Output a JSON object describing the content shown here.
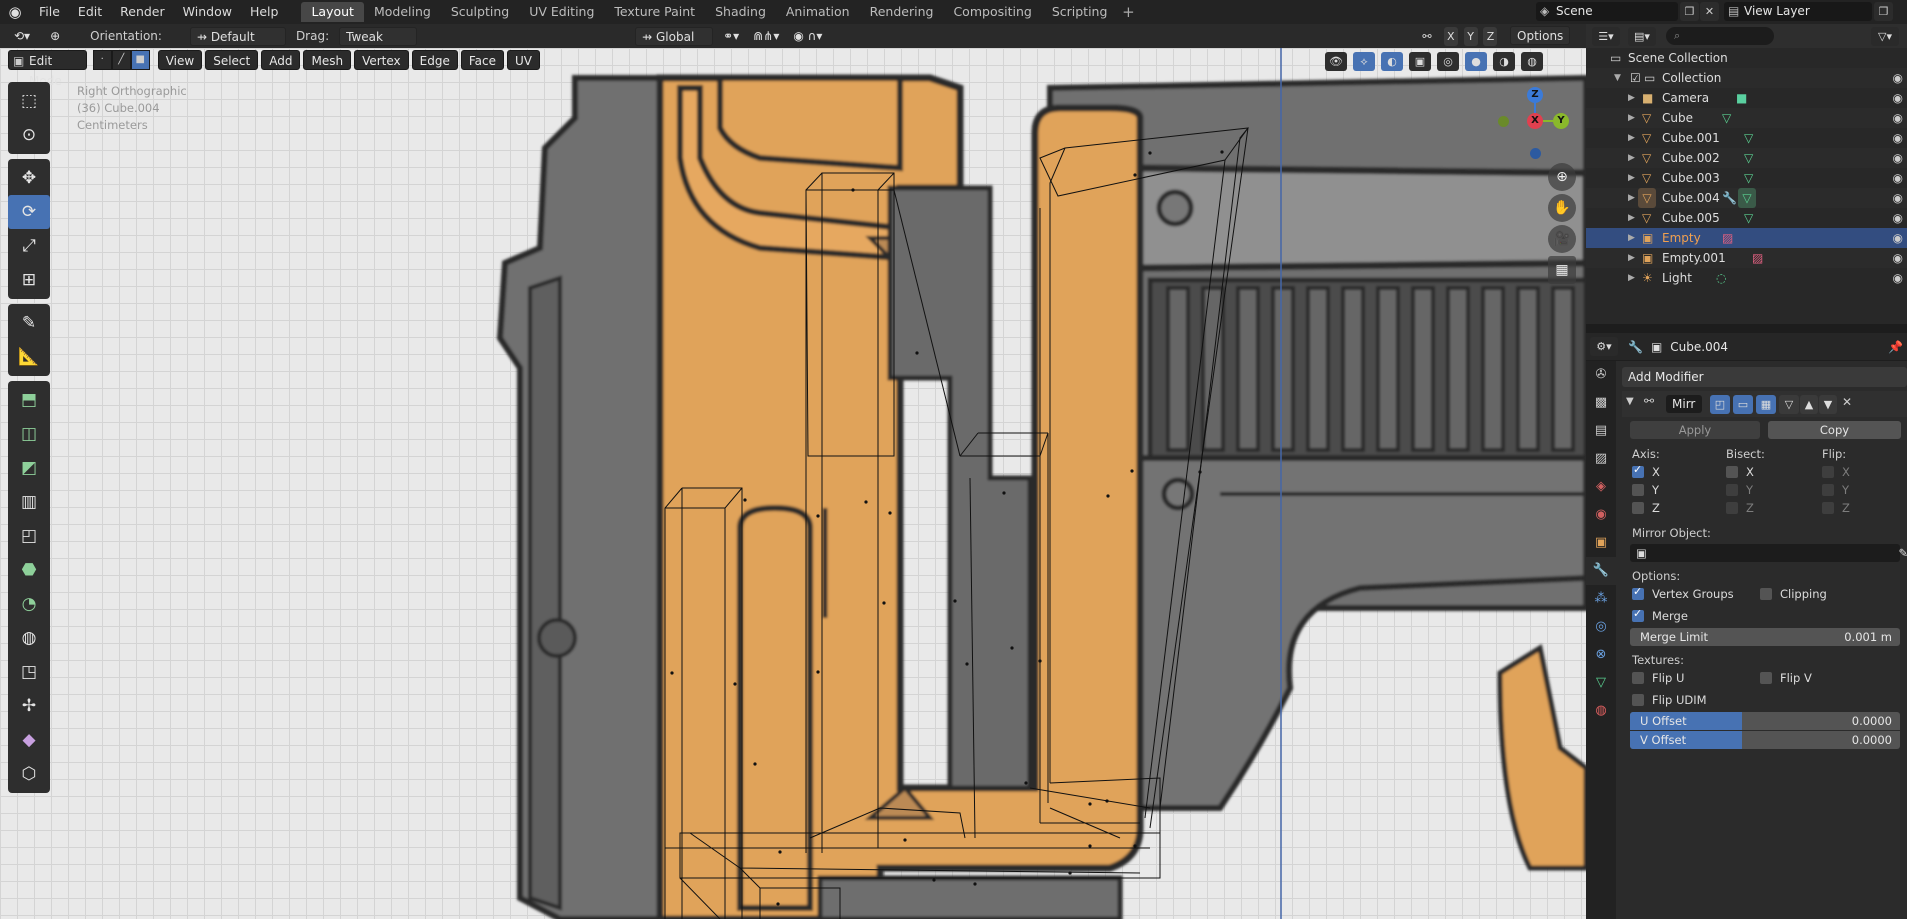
{
  "topbar": {
    "menus": [
      "File",
      "Edit",
      "Render",
      "Window",
      "Help"
    ],
    "workspaces": [
      "Layout",
      "Modeling",
      "Sculpting",
      "UV Editing",
      "Texture Paint",
      "Shading",
      "Animation",
      "Rendering",
      "Compositing",
      "Scripting"
    ],
    "active_workspace": "Layout",
    "scene": "Scene",
    "view_layer": "View Layer"
  },
  "viewport_header": {
    "orientation_label": "Orientation:",
    "orientation_value": "Default",
    "drag_label": "Drag:",
    "drag_value": "Tweak",
    "transform_orientation": "Global",
    "options": "Options",
    "axis_x": "X",
    "axis_y": "Y",
    "axis_z": "Z"
  },
  "mode_header": {
    "mode": "Edit Mode",
    "menus": [
      "View",
      "Select",
      "Add",
      "Mesh",
      "Vertex",
      "Edge",
      "Face",
      "UV"
    ]
  },
  "overlay": {
    "view_name": "Right Orthographic",
    "object_info": "(36) Cube.004",
    "units": "Centimeters"
  },
  "gizmo": {
    "x": "X",
    "y": "Y",
    "z": "Z"
  },
  "toolbar": {
    "tools": [
      "select-box",
      "cursor",
      "move",
      "rotate",
      "scale",
      "transform",
      "annotate",
      "measure",
      "extrude-region",
      "inset-faces",
      "bevel",
      "loop-cut",
      "knife",
      "poly-build",
      "spin",
      "smooth",
      "edge-slide",
      "shrink-fatten",
      "shear",
      "rip-region"
    ],
    "active_tool": "rotate"
  },
  "outliner": {
    "root": "Scene Collection",
    "collection": "Collection",
    "items": [
      {
        "name": "Camera",
        "type": "camera"
      },
      {
        "name": "Cube",
        "type": "mesh"
      },
      {
        "name": "Cube.001",
        "type": "mesh"
      },
      {
        "name": "Cube.002",
        "type": "mesh"
      },
      {
        "name": "Cube.003",
        "type": "mesh"
      },
      {
        "name": "Cube.004",
        "type": "mesh"
      },
      {
        "name": "Cube.005",
        "type": "mesh"
      },
      {
        "name": "Empty",
        "type": "empty",
        "selected": true
      },
      {
        "name": "Empty.001",
        "type": "empty"
      },
      {
        "name": "Light",
        "type": "light"
      }
    ]
  },
  "properties": {
    "object_name": "Cube.004",
    "add_modifier": "Add Modifier",
    "modifier_name": "Mirr",
    "apply": "Apply",
    "copy": "Copy",
    "axis_label": "Axis:",
    "bisect_label": "Bisect:",
    "flip_label": "Flip:",
    "axis": {
      "x": "X",
      "y": "Y",
      "z": "Z"
    },
    "axis_x_checked": true,
    "mirror_object_label": "Mirror Object:",
    "options_label": "Options:",
    "vertex_groups": "Vertex Groups",
    "clipping": "Clipping",
    "merge": "Merge",
    "merge_limit_label": "Merge Limit",
    "merge_limit_value": "0.001 m",
    "textures_label": "Textures:",
    "flip_u": "Flip U",
    "flip_v": "Flip V",
    "flip_udim": "Flip UDIM",
    "u_offset_label": "U Offset",
    "u_offset_value": "0.0000",
    "v_offset_label": "V Offset",
    "v_offset_value": "0.0000"
  },
  "colors": {
    "accent": "#4772b3",
    "orange": "#e0a35a",
    "grey_metal": "#6b6b6b"
  }
}
